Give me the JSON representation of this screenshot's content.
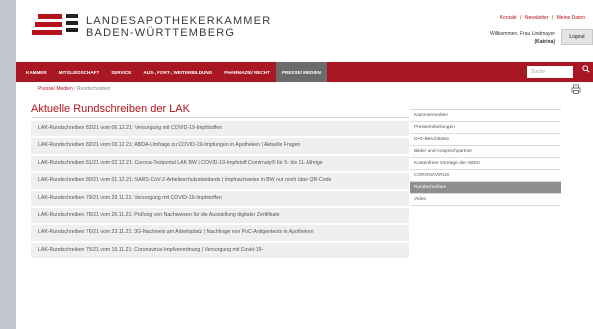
{
  "header": {
    "logo_line1": "LANDESAPOTHEKERKAMMER",
    "logo_line2": "BADEN-WÜRTTEMBERG",
    "top_links": [
      "Kontakt",
      "/",
      "Newsletter",
      "/",
      "Meine Daten"
    ],
    "welcome": "Willkommen, Frau Lindmayer",
    "welcome_name": "(Katrina)",
    "logout_label": "Logout"
  },
  "nav": {
    "items": [
      "KAMMER",
      "MITGLIEDSCHAFT",
      "SERVICE",
      "AUS-, FORT-, WEITERBILDUNG",
      "PHARMAZIE/ RECHT",
      "PRESSE/ MEDIEN"
    ],
    "search_placeholder": "Suche"
  },
  "breadcrumb": {
    "link": "Presse/ Medien",
    "sep": " / ",
    "current": "Rundschreiben"
  },
  "main": {
    "title": "Aktuelle Rundschreiben der LAK",
    "items": [
      "LAK-Rundschreiben 83/21 vom 06.12.21: Versorgung mit COVID-19-Impfstoffen",
      "LAK-Rundschreiben 82/21 vom 03.12.21: ABDA-Umfrage zu COVID-19-Impfungen in Apotheken | Aktuelle Fragen",
      "LAK-Rundschreiben 81/21 vom 02.12.21: Corona-Testportal LAK BW | COVID-19-Impfstoff Comirnaty® für 5- bis 11-Jährige",
      "LAK-Rundschreiben 80/21 vom 01.12.21: SARS-CoV-2-Arbeitsschutzstandards | Impfnachweise in BW nur noch über QR-Code",
      "LAK-Rundschreiben 79/21 vom 29.11.21: Versorgung mit COVID-19-Impfstoffen",
      "LAK-Rundschreiben 78/21 vom 26.11.21: Prüfung von Nachweisen für die Ausstellung digitaler Zertifikate",
      "LAK-Rundschreiben 76/21 vom 23.11.21: 3G-Nachweis am Arbeitsplatz | Nachfrage von PoC-Antigentests in Apotheken",
      "LAK-Rundschreiben 75/21 vom 19.11.21: Coronavirus-Impfverordnung | Versorgung mit Covid-19-"
    ]
  },
  "sidebar": {
    "items": [
      "Kammermedien",
      "Pressemitteilungen",
      "DAT-Beschlüsse",
      "Bilder und Ansprechpartner",
      "Kostenfreie Vorträge der ABDA",
      "CORONAVIRUS",
      "Rundschreiben",
      "Video"
    ],
    "active_index": 6
  },
  "colors": {
    "brand_red": "#a81722",
    "title_red": "#b5121b"
  }
}
